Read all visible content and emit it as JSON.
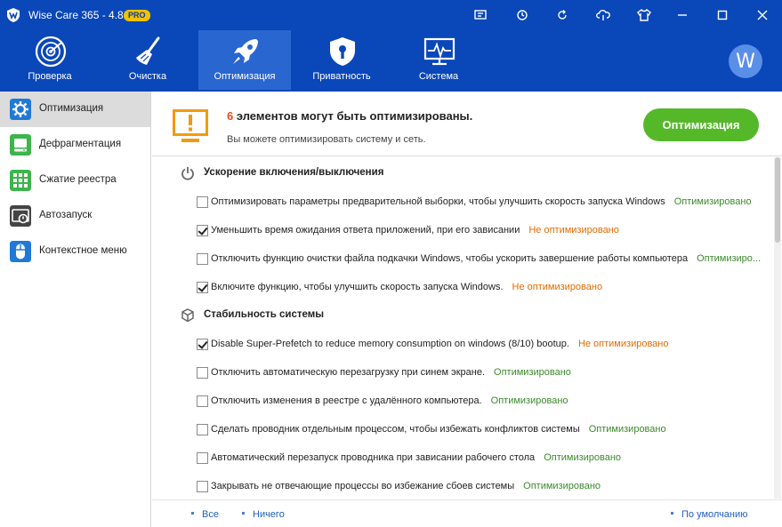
{
  "app": {
    "title": "Wise Care 365 - 4.8.4",
    "badge": "PRO"
  },
  "titlebar_buttons": [
    "feedback-icon",
    "update-icon",
    "refresh-icon",
    "cloud-icon",
    "shirt-icon",
    "minimize-icon",
    "maximize-icon",
    "close-icon"
  ],
  "nav": {
    "items": [
      {
        "label": "Проверка",
        "icon": "radar-icon"
      },
      {
        "label": "Очистка",
        "icon": "broom-icon"
      },
      {
        "label": "Оптимизация",
        "icon": "rocket-icon"
      },
      {
        "label": "Приватность",
        "icon": "shield-icon"
      },
      {
        "label": "Система",
        "icon": "monitor-icon"
      }
    ],
    "active": "Оптимизация",
    "avatar_letter": "W"
  },
  "sidebar": {
    "items": [
      {
        "label": "Оптимизация",
        "icon": "optimize-gear-icon",
        "color": "#1e7ad6"
      },
      {
        "label": "Дефрагментация",
        "icon": "disk-icon",
        "color": "#3cb54a"
      },
      {
        "label": "Сжатие реестра",
        "icon": "registry-icon",
        "color": "#3cb54a"
      },
      {
        "label": "Автозапуск",
        "icon": "startup-icon",
        "color": "#444444"
      },
      {
        "label": "Контекстное меню",
        "icon": "mouse-icon",
        "color": "#1e7ad6"
      }
    ]
  },
  "header": {
    "count": "6",
    "title_rest": " элементов могут быть оптимизированы.",
    "subtitle": "Вы можете оптимизировать систему и сеть.",
    "button": "Оптимизация"
  },
  "sections": [
    {
      "title": "Ускорение включения/выключения",
      "icon": "power-icon",
      "rows": [
        {
          "text": "Оптимизировать параметры предварительной выборки, чтобы улучшить скорость запуска Windows",
          "status": "Оптимизировано",
          "ok": true,
          "checked": false
        },
        {
          "text": "Уменьшить время ожидания ответа приложений, при его зависании",
          "status": "Не оптимизировано",
          "ok": false,
          "checked": true
        },
        {
          "text": "Отключить функцию очистки файла подкачки Windows, чтобы ускорить завершение работы компьютера",
          "status": "Оптимизиро...",
          "ok": true,
          "checked": false
        },
        {
          "text": "Включите функцию, чтобы улучшить скорость запуска Windows.",
          "status": "Не оптимизировано",
          "ok": false,
          "checked": true
        }
      ]
    },
    {
      "title": "Стабильность системы",
      "icon": "cube-icon",
      "rows": [
        {
          "text": "Disable Super-Prefetch to reduce memory consumption on windows (8/10) bootup.",
          "status": "Не оптимизировано",
          "ok": false,
          "checked": true
        },
        {
          "text": "Отключить автоматическую перезагрузку при синем экране.",
          "status": "Оптимизировано",
          "ok": true,
          "checked": false
        },
        {
          "text": "Отключить изменения в реестре с удалённого компьютера.",
          "status": "Оптимизировано",
          "ok": true,
          "checked": false
        },
        {
          "text": "Сделать проводник отдельным процессом, чтобы избежать конфликтов системы",
          "status": "Оптимизировано",
          "ok": true,
          "checked": false
        },
        {
          "text": "Автоматический перезапуск проводника при зависании рабочего стола",
          "status": "Оптимизировано",
          "ok": true,
          "checked": false
        },
        {
          "text": "Закрывать не отвечающие процессы во избежание сбоев системы",
          "status": "Оптимизировано",
          "ok": true,
          "checked": false
        }
      ]
    }
  ],
  "footer": {
    "all": "Все",
    "none": "Ничего",
    "default": "По умолчанию"
  }
}
